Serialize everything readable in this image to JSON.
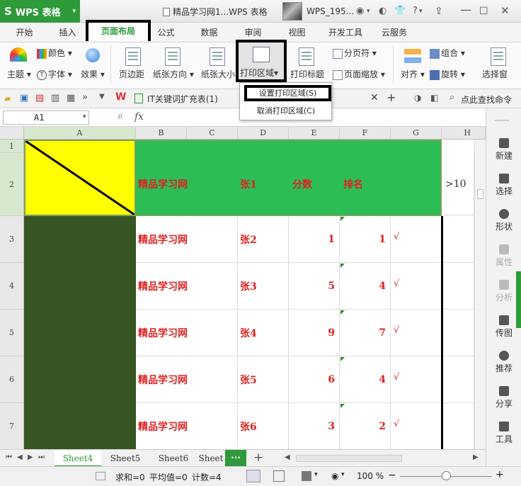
{
  "app": {
    "name": "WPS 表格",
    "doc_title": "精品学习网1...WPS 表格",
    "user": "WPS_195..."
  },
  "menu_tabs": [
    "开始",
    "插入",
    "页面布局",
    "公式",
    "数据",
    "审阅",
    "视图",
    "开发工具",
    "云服务"
  ],
  "ribbon": {
    "theme": "主题",
    "colors": "颜色",
    "font": "字体",
    "effects": "效果",
    "margins": "页边距",
    "orientation": "纸张方向",
    "size": "纸张大小",
    "print_area": "打印区域",
    "print_titles": "打印标题",
    "page_break": "分页符",
    "page_zoom": "页面缩放",
    "align": "对齐",
    "group": "组合",
    "rotate": "旋转",
    "select_pane": "选择窗"
  },
  "print_area_menu": {
    "set": "设置打印区域(S)",
    "cancel": "取消打印区域(C)"
  },
  "doc_tab": {
    "label": "IT关键词扩充表(1)",
    "search": "点此查找命令"
  },
  "formula_bar": {
    "name_box": "A1",
    "fx": "fx"
  },
  "columns": [
    "A",
    "B",
    "C",
    "D",
    "E",
    "F",
    "G",
    "H"
  ],
  "rows": [
    "1",
    "2",
    "3",
    "4",
    "5",
    "6",
    "7"
  ],
  "header_row": {
    "b": "精品学习网",
    "d": "张1",
    "e": "分数",
    "f": "排名",
    "h": ">10"
  },
  "data_rows": [
    {
      "b": "精品学习网",
      "d": "张2",
      "e": "1",
      "f": "1",
      "g": "√"
    },
    {
      "b": "精品学习网",
      "d": "张3",
      "e": "5",
      "f": "4",
      "g": "√"
    },
    {
      "b": "精品学习网",
      "d": "张4",
      "e": "9",
      "f": "7",
      "g": "√"
    },
    {
      "b": "精品学习网",
      "d": "张5",
      "e": "6",
      "f": "4",
      "g": "√"
    },
    {
      "b": "精品学习网",
      "d": "张6",
      "e": "3",
      "f": "2",
      "g": "√"
    }
  ],
  "right_panel": [
    "新建",
    "选择",
    "形状",
    "属性",
    "分析",
    "传图",
    "推荐",
    "分享",
    "工具"
  ],
  "sheet_tabs": [
    "Sheet4",
    "Sheet5",
    "Sheet6",
    "Sheet"
  ],
  "status": {
    "sum": "求和=0",
    "avg": "平均值=0",
    "count": "计数=4",
    "zoom": "100 %"
  },
  "colors": {
    "accent": "#2f9a3a",
    "header_fill": "#2dbd57",
    "yellow": "#ffff00",
    "dark_green": "#375623",
    "text_red": "#dd2222"
  }
}
